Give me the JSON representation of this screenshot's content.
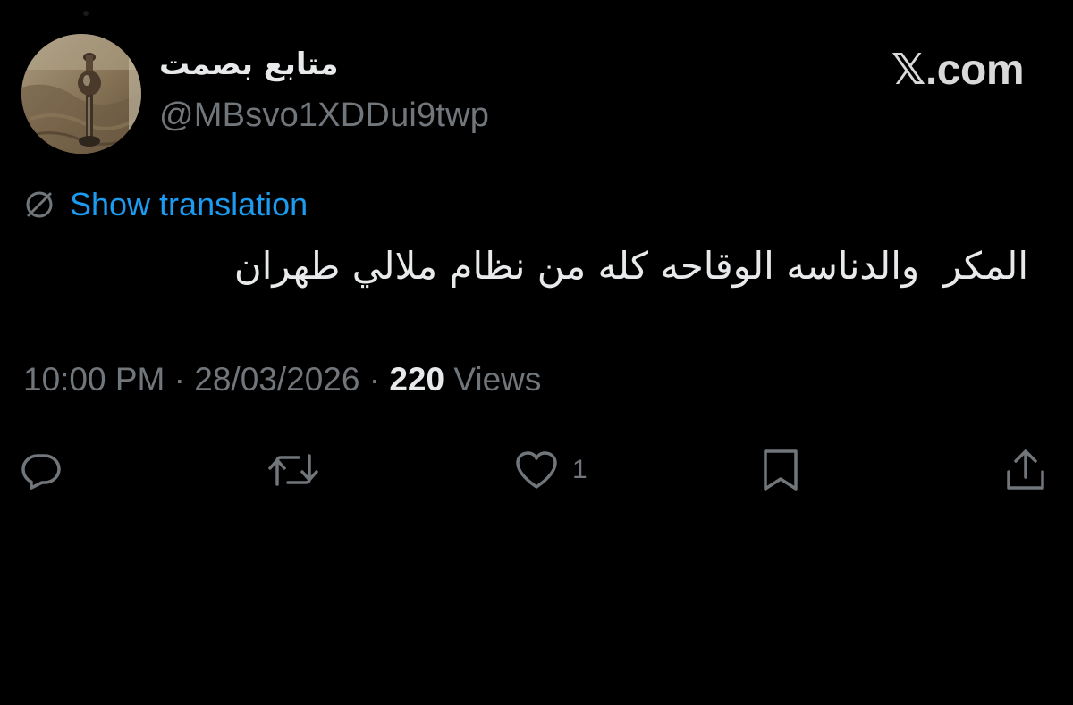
{
  "header": {
    "display_name": "متابع بصمت",
    "handle": "@MBsvo1XDDui9twp",
    "brand": "𝕏.com"
  },
  "translation": {
    "label": "Show translation",
    "icon": "globe-slash-icon"
  },
  "tweet": {
    "text": "المكر  والدناسه الوقاحه كله من نظام ملالي طهران"
  },
  "meta": {
    "time": "10:00 PM",
    "separator": " · ",
    "date": "28/03/2026",
    "views_count": "220",
    "views_label": " Views"
  },
  "actions": {
    "reply": {
      "icon": "reply-icon",
      "count": ""
    },
    "repost": {
      "icon": "repost-icon",
      "count": ""
    },
    "like": {
      "icon": "heart-icon",
      "count": "1"
    },
    "bookmark": {
      "icon": "bookmark-icon",
      "count": ""
    },
    "share": {
      "icon": "share-icon",
      "count": ""
    }
  },
  "colors": {
    "background": "#000000",
    "text_primary": "#e7e9ea",
    "text_secondary": "#71767b",
    "accent": "#1d9bf0"
  }
}
